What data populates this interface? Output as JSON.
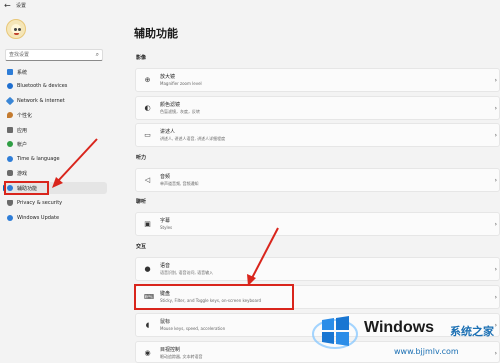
{
  "app": {
    "title": "设置",
    "back_icon": "back-arrow-icon"
  },
  "search": {
    "placeholder": "查找设置"
  },
  "sidebar": {
    "items": [
      {
        "label": "系统",
        "icon": "system-icon",
        "color": "#2e7dd7"
      },
      {
        "label": "Bluetooth & devices",
        "icon": "bluetooth-icon",
        "color": "#1f6fd0"
      },
      {
        "label": "Network & internet",
        "icon": "network-icon",
        "color": "#3a86d6"
      },
      {
        "label": "个性化",
        "icon": "personalization-icon",
        "color": "#c47b2f"
      },
      {
        "label": "应用",
        "icon": "apps-icon",
        "color": "#6b6b6b"
      },
      {
        "label": "帐户",
        "icon": "accounts-icon",
        "color": "#2f9e44"
      },
      {
        "label": "Time & language",
        "icon": "time-language-icon",
        "color": "#2e7dd7"
      },
      {
        "label": "游戏",
        "icon": "gaming-icon",
        "color": "#6b6b6b"
      },
      {
        "label": "辅助功能",
        "icon": "accessibility-icon",
        "color": "#2e7dd7",
        "active": true
      },
      {
        "label": "Privacy & security",
        "icon": "privacy-icon",
        "color": "#6b6b6b"
      },
      {
        "label": "Windows Update",
        "icon": "update-icon",
        "color": "#2e7dd7"
      }
    ]
  },
  "main": {
    "title": "辅助功能",
    "sections": {
      "vision": "影像",
      "hearing": "听力",
      "interaction_top": "聊听",
      "interaction": "交互"
    },
    "cards": {
      "magnifier": {
        "title": "放大镜",
        "desc": "Magnifier zoom level"
      },
      "color_filters": {
        "title": "颜色滤镜",
        "desc": "色盲滤镜，灰度，反转"
      },
      "narrator": {
        "title": "讲述人",
        "desc": "讲述人, 讲述人语音, 讲述人详细程度"
      },
      "audio": {
        "title": "音频",
        "desc": "单声道音频, 音频通知"
      },
      "captions": {
        "title": "字幕",
        "desc": "Styles"
      },
      "speech": {
        "title": "语音",
        "desc": "语音识别, 语音访问, 语音输入"
      },
      "keyboard": {
        "title": "键盘",
        "desc": "Sticky, Filter, and Toggle keys, on-screen keyboard"
      },
      "mouse": {
        "title": "鼠标",
        "desc": "Mouse keys, speed, acceleration"
      },
      "eye_control": {
        "title": "目视控制",
        "desc": "眼动追踪器, 文本转语音"
      }
    }
  },
  "watermark": {
    "brand": "Windows",
    "cn": "系统之家",
    "url": "www.bjjmlv.com"
  },
  "colors": {
    "accent": "#0067c0",
    "annotation": "#d9251c"
  }
}
